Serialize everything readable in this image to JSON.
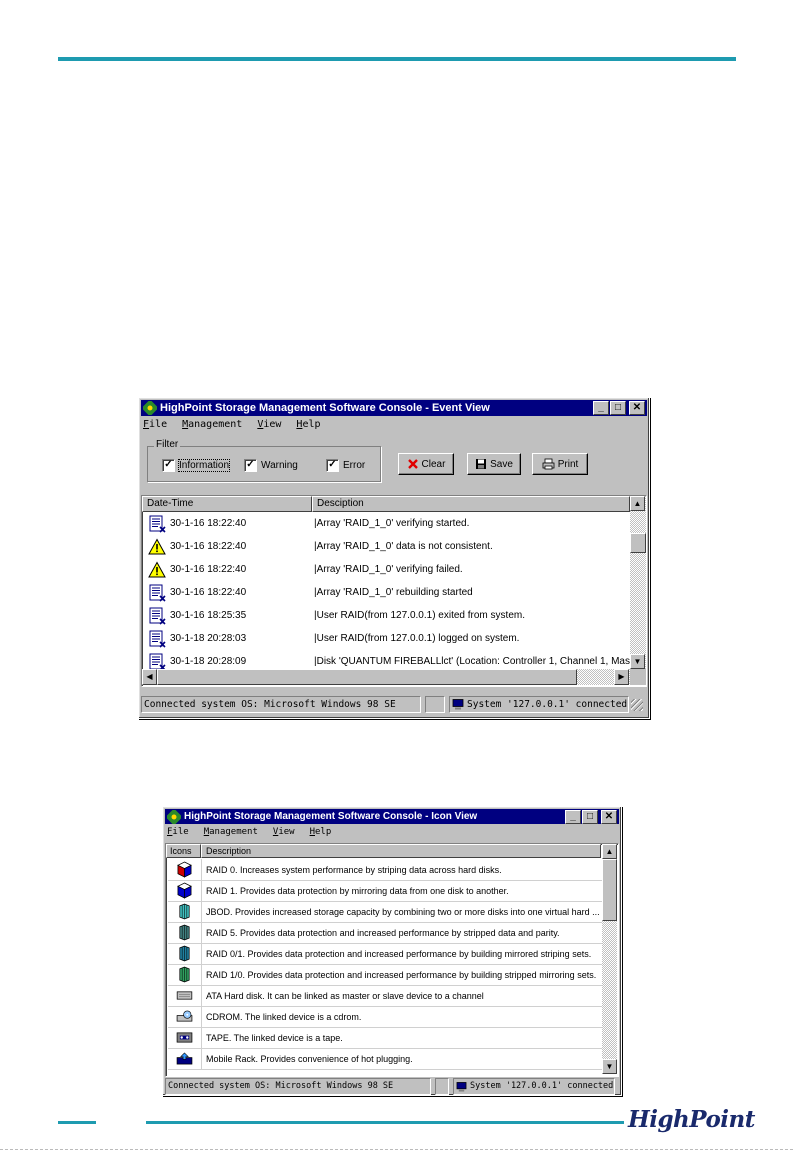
{
  "event_window": {
    "title": "HighPoint Storage Management Software Console - Event View",
    "menu": [
      "File",
      "Management",
      "View",
      "Help"
    ],
    "filter": {
      "legend": "Filter",
      "information": "Information",
      "warning": "Warning",
      "error": "Error"
    },
    "buttons": {
      "clear": "Clear",
      "save": "Save",
      "print": "Print"
    },
    "columns": {
      "datetime": "Date-Time",
      "description": "Desciption"
    },
    "rows": [
      {
        "icon": "info-icon",
        "datetime": "30-1-16 18:22:40",
        "description": "|Array 'RAID_1_0' verifying started."
      },
      {
        "icon": "warning-icon",
        "datetime": "30-1-16 18:22:40",
        "description": "|Array 'RAID_1_0' data is not consistent."
      },
      {
        "icon": "warning-icon",
        "datetime": "30-1-16 18:22:40",
        "description": "|Array 'RAID_1_0' verifying failed."
      },
      {
        "icon": "info-icon",
        "datetime": "30-1-16 18:22:40",
        "description": "|Array 'RAID_1_0' rebuilding started"
      },
      {
        "icon": "info-icon",
        "datetime": "30-1-16 18:25:35",
        "description": "|User RAID(from 127.0.0.1) exited from system."
      },
      {
        "icon": "info-icon",
        "datetime": "30-1-18 20:28:03",
        "description": "|User RAID(from 127.0.0.1) logged on system."
      },
      {
        "icon": "info-icon",
        "datetime": "30-1-18 20:28:09",
        "description": "|Disk 'QUANTUM FIREBALLlct' (Location: Controller 1, Channel 1, Mas"
      }
    ],
    "status": {
      "os": "Connected system OS: Microsoft Windows 98 SE",
      "connection": "System '127.0.0.1' connected"
    }
  },
  "icon_window": {
    "title": "HighPoint Storage Management Software Console - Icon View",
    "menu": [
      "File",
      "Management",
      "View",
      "Help"
    ],
    "columns": {
      "icons": "Icons",
      "description": "Description"
    },
    "rows": [
      {
        "icon": "raid0-icon",
        "description": "RAID 0. Increases system performance by striping data across hard disks."
      },
      {
        "icon": "raid1-icon",
        "description": "RAID 1. Provides data protection by mirroring data from one disk to another."
      },
      {
        "icon": "jbod-icon",
        "description": "JBOD. Provides increased storage capacity by combining two or more disks into one virtual hard ..."
      },
      {
        "icon": "raid5-icon",
        "description": "RAID 5. Provides data protection and increased performance by stripped data and parity."
      },
      {
        "icon": "raid01-icon",
        "description": "RAID 0/1. Provides data protection and increased performance by building mirrored striping sets."
      },
      {
        "icon": "raid10-icon",
        "description": "RAID 1/0. Provides data protection and increased performance by building stripped mirroring sets."
      },
      {
        "icon": "hard-disk-icon",
        "description": "ATA Hard disk. It can be linked as master or slave device to a channel"
      },
      {
        "icon": "cdrom-icon",
        "description": "CDROM. The linked device is a cdrom."
      },
      {
        "icon": "tape-icon",
        "description": "TAPE. The linked device is a tape."
      },
      {
        "icon": "mobile-rack-icon",
        "description": "Mobile Rack. Provides convenience of hot plugging."
      }
    ],
    "status": {
      "os": "Connected system OS: Microsoft Windows 98 SE",
      "connection": "System '127.0.0.1' connected"
    }
  },
  "footer": {
    "logo": "HighPoint"
  },
  "colors": {
    "accent_line": "#1e9bb0",
    "titlebar": "#000080",
    "window_face": "#c0c0c0",
    "logo": "#1a2a6c"
  }
}
